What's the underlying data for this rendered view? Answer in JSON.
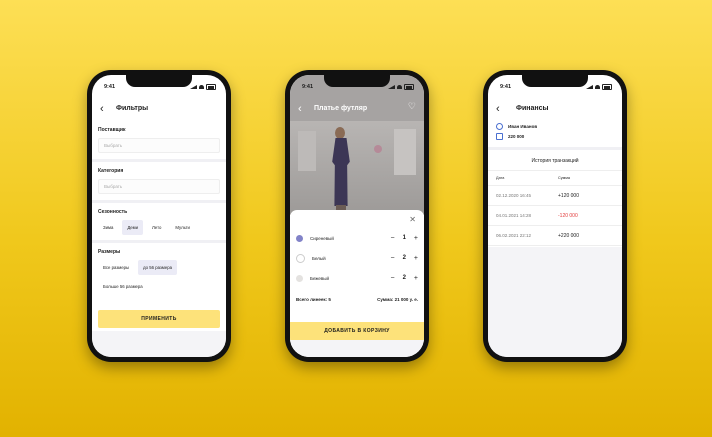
{
  "status_time": "9:41",
  "accent_color": "#fde27a",
  "filters": {
    "title": "Фильтры",
    "provider": {
      "label": "Поставщик",
      "placeholder": "Выбрать"
    },
    "category": {
      "label": "Категория",
      "placeholder": "Выбрать"
    },
    "season": {
      "label": "Сезонность",
      "options": [
        "Зима",
        "Деми",
        "Лето",
        "Мульти"
      ],
      "selected": "Деми"
    },
    "sizes": {
      "label": "Размеры",
      "options": [
        "Все размеры",
        "до 56 размера",
        "Больше 56 размера"
      ],
      "selected": "до 56 размера"
    },
    "apply_button": "ПРИМЕНИТЬ"
  },
  "product": {
    "title": "Платье футляр",
    "colors": [
      {
        "name": "Сиреневый",
        "qty": "1",
        "color": "#8283c8"
      },
      {
        "name": "Белый",
        "qty": "2",
        "color": "#ffffff"
      },
      {
        "name": "Бежевый",
        "qty": "2",
        "color": "#e4e2e0"
      }
    ],
    "total_lines": "Всего линеек: 5",
    "total_sum": "Сумма: 21 000 у. е.",
    "cart_button": "ДОБАВИТЬ В КОРЗИНУ"
  },
  "finance": {
    "title": "Финансы",
    "user_name": "Иван Иванов",
    "balance": "220 000",
    "history_title": "История транзакций",
    "columns": [
      "Дата",
      "Сумма"
    ],
    "rows": [
      {
        "date": "02.12.2020 16:45",
        "amount": "+120 000"
      },
      {
        "date": "04.01.2021 14:28",
        "amount": "-120 000"
      },
      {
        "date": "06.02.2021 22:12",
        "amount": "+220 000"
      }
    ]
  }
}
